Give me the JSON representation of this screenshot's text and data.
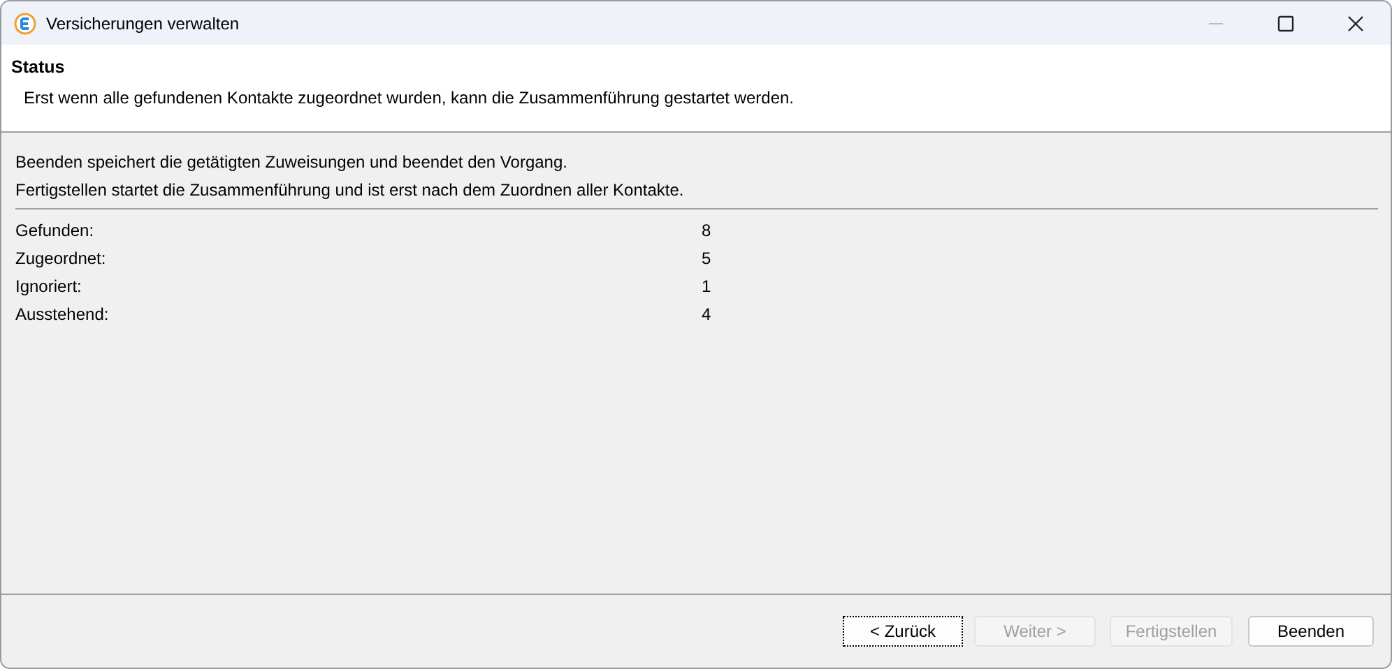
{
  "window": {
    "title": "Versicherungen verwalten"
  },
  "header": {
    "title": "Status",
    "description": "Erst wenn alle gefundenen Kontakte zugeordnet wurden, kann die Zusammenführung gestartet werden."
  },
  "info": [
    "Beenden speichert die getätigten Zuweisungen und beendet den Vorgang.",
    "Fertigstellen startet die Zusammenführung und ist erst nach dem Zuordnen aller Kontakte."
  ],
  "stats": [
    {
      "label": "Gefunden:",
      "value": "8"
    },
    {
      "label": "Zugeordnet:",
      "value": "5"
    },
    {
      "label": "Ignoriert:",
      "value": "1"
    },
    {
      "label": "Ausstehend:",
      "value": "4"
    }
  ],
  "buttons": [
    {
      "label": "< Zurück",
      "disabled": false,
      "focused": true
    },
    {
      "label": "Weiter >",
      "disabled": true,
      "focused": false
    },
    {
      "label": "Fertigstellen",
      "disabled": true,
      "focused": false
    },
    {
      "label": "Beenden",
      "disabled": false,
      "focused": false
    }
  ]
}
